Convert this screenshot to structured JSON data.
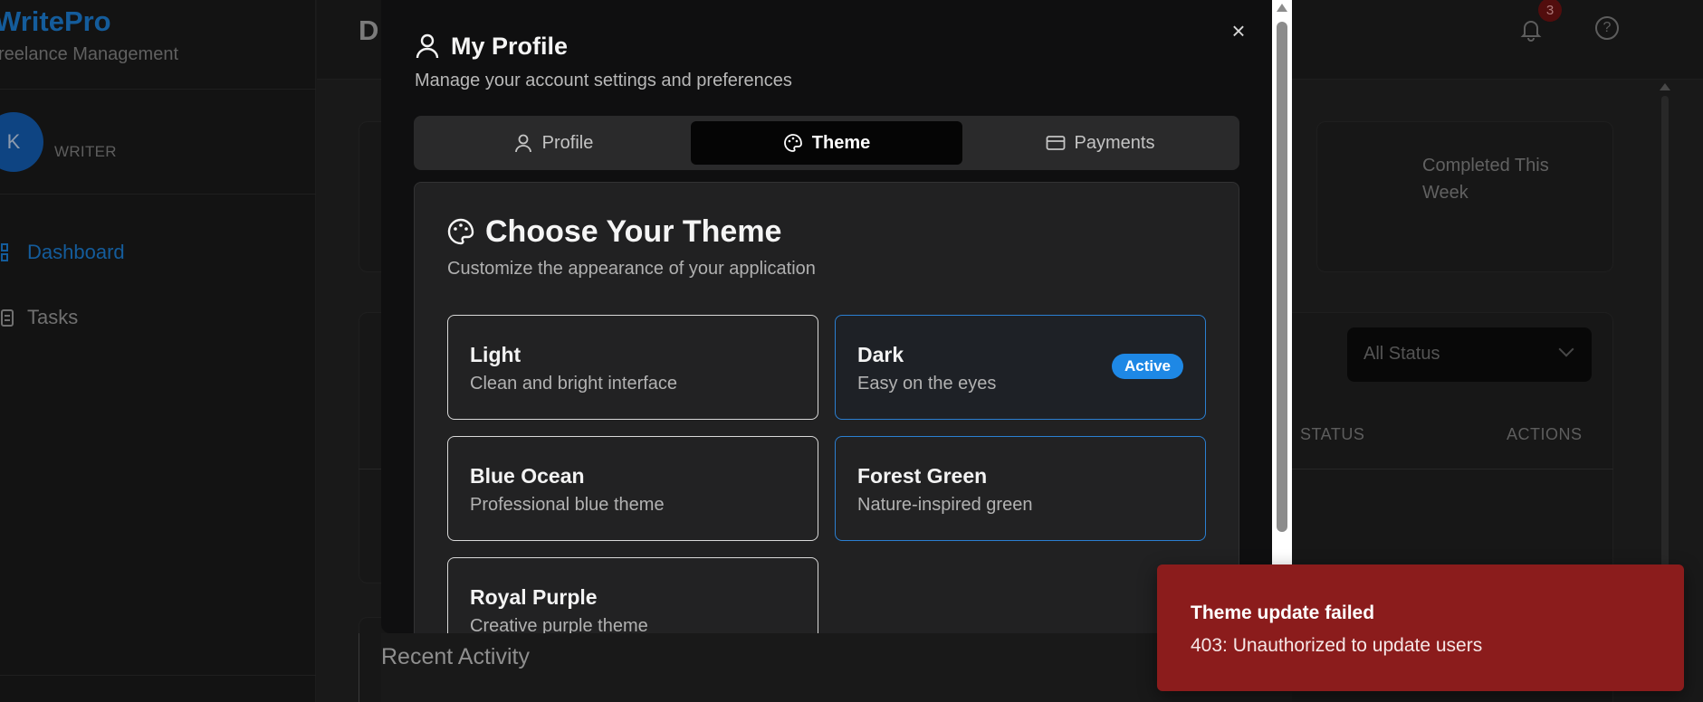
{
  "app": {
    "brand": "WritePro",
    "brand_subtitle": "reelance Management",
    "user": {
      "avatar_initial": "K",
      "role": "WRITER"
    },
    "nav": [
      {
        "label": "Dashboard",
        "icon": "dashboard-icon",
        "active": true
      },
      {
        "label": "Tasks",
        "icon": "clipboard-icon",
        "active": false
      }
    ],
    "page_title": "D",
    "notifications_count": "3",
    "help_glyph": "?",
    "stat_label": "Completed This Week",
    "status_filter": "All Status",
    "table_headers": {
      "status": "STATUS",
      "actions": "ACTIONS"
    },
    "recent_activity_title": "Recent Activity"
  },
  "modal": {
    "title": "My Profile",
    "subtitle": "Manage your account settings and preferences",
    "close_glyph": "×",
    "tabs": [
      {
        "label": "Profile",
        "icon": "user-icon",
        "active": false
      },
      {
        "label": "Theme",
        "icon": "palette-icon",
        "active": true
      },
      {
        "label": "Payments",
        "icon": "credit-card-icon",
        "active": false
      }
    ],
    "theme_section": {
      "title": "Choose Your Theme",
      "subtitle": "Customize the appearance of your application",
      "options": [
        {
          "name": "Light",
          "description": "Clean and bright interface"
        },
        {
          "name": "Dark",
          "description": "Easy on the eyes",
          "badge": "Active"
        },
        {
          "name": "Blue Ocean",
          "description": "Professional blue theme"
        },
        {
          "name": "Forest Green",
          "description": "Nature-inspired green"
        },
        {
          "name": "Royal Purple",
          "description": "Creative purple theme"
        }
      ]
    }
  },
  "toast": {
    "title": "Theme update failed",
    "message": "403: Unauthorized to update users"
  },
  "colors": {
    "accent": "#1e88e5",
    "error": "#8b1c1c",
    "modal_bg": "#0f0f10"
  }
}
